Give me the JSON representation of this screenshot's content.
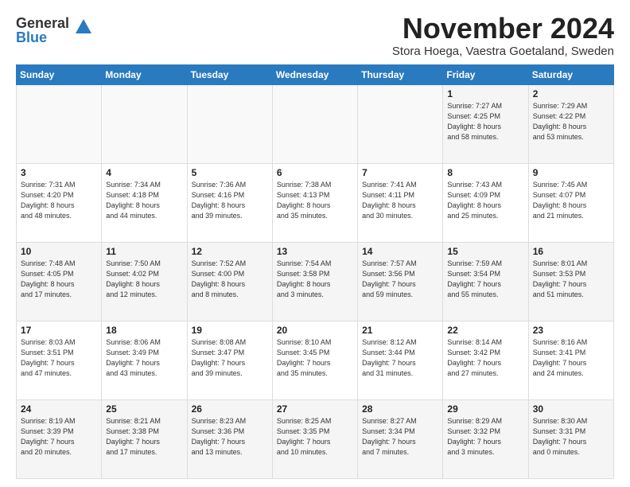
{
  "logo": {
    "general": "General",
    "blue": "Blue"
  },
  "title": "November 2024",
  "location": "Stora Hoega, Vaestra Goetaland, Sweden",
  "days_header": [
    "Sunday",
    "Monday",
    "Tuesday",
    "Wednesday",
    "Thursday",
    "Friday",
    "Saturday"
  ],
  "weeks": [
    [
      {
        "day": "",
        "info": ""
      },
      {
        "day": "",
        "info": ""
      },
      {
        "day": "",
        "info": ""
      },
      {
        "day": "",
        "info": ""
      },
      {
        "day": "",
        "info": ""
      },
      {
        "day": "1",
        "info": "Sunrise: 7:27 AM\nSunset: 4:25 PM\nDaylight: 8 hours\nand 58 minutes."
      },
      {
        "day": "2",
        "info": "Sunrise: 7:29 AM\nSunset: 4:22 PM\nDaylight: 8 hours\nand 53 minutes."
      }
    ],
    [
      {
        "day": "3",
        "info": "Sunrise: 7:31 AM\nSunset: 4:20 PM\nDaylight: 8 hours\nand 48 minutes."
      },
      {
        "day": "4",
        "info": "Sunrise: 7:34 AM\nSunset: 4:18 PM\nDaylight: 8 hours\nand 44 minutes."
      },
      {
        "day": "5",
        "info": "Sunrise: 7:36 AM\nSunset: 4:16 PM\nDaylight: 8 hours\nand 39 minutes."
      },
      {
        "day": "6",
        "info": "Sunrise: 7:38 AM\nSunset: 4:13 PM\nDaylight: 8 hours\nand 35 minutes."
      },
      {
        "day": "7",
        "info": "Sunrise: 7:41 AM\nSunset: 4:11 PM\nDaylight: 8 hours\nand 30 minutes."
      },
      {
        "day": "8",
        "info": "Sunrise: 7:43 AM\nSunset: 4:09 PM\nDaylight: 8 hours\nand 25 minutes."
      },
      {
        "day": "9",
        "info": "Sunrise: 7:45 AM\nSunset: 4:07 PM\nDaylight: 8 hours\nand 21 minutes."
      }
    ],
    [
      {
        "day": "10",
        "info": "Sunrise: 7:48 AM\nSunset: 4:05 PM\nDaylight: 8 hours\nand 17 minutes."
      },
      {
        "day": "11",
        "info": "Sunrise: 7:50 AM\nSunset: 4:02 PM\nDaylight: 8 hours\nand 12 minutes."
      },
      {
        "day": "12",
        "info": "Sunrise: 7:52 AM\nSunset: 4:00 PM\nDaylight: 8 hours\nand 8 minutes."
      },
      {
        "day": "13",
        "info": "Sunrise: 7:54 AM\nSunset: 3:58 PM\nDaylight: 8 hours\nand 3 minutes."
      },
      {
        "day": "14",
        "info": "Sunrise: 7:57 AM\nSunset: 3:56 PM\nDaylight: 7 hours\nand 59 minutes."
      },
      {
        "day": "15",
        "info": "Sunrise: 7:59 AM\nSunset: 3:54 PM\nDaylight: 7 hours\nand 55 minutes."
      },
      {
        "day": "16",
        "info": "Sunrise: 8:01 AM\nSunset: 3:53 PM\nDaylight: 7 hours\nand 51 minutes."
      }
    ],
    [
      {
        "day": "17",
        "info": "Sunrise: 8:03 AM\nSunset: 3:51 PM\nDaylight: 7 hours\nand 47 minutes."
      },
      {
        "day": "18",
        "info": "Sunrise: 8:06 AM\nSunset: 3:49 PM\nDaylight: 7 hours\nand 43 minutes."
      },
      {
        "day": "19",
        "info": "Sunrise: 8:08 AM\nSunset: 3:47 PM\nDaylight: 7 hours\nand 39 minutes."
      },
      {
        "day": "20",
        "info": "Sunrise: 8:10 AM\nSunset: 3:45 PM\nDaylight: 7 hours\nand 35 minutes."
      },
      {
        "day": "21",
        "info": "Sunrise: 8:12 AM\nSunset: 3:44 PM\nDaylight: 7 hours\nand 31 minutes."
      },
      {
        "day": "22",
        "info": "Sunrise: 8:14 AM\nSunset: 3:42 PM\nDaylight: 7 hours\nand 27 minutes."
      },
      {
        "day": "23",
        "info": "Sunrise: 8:16 AM\nSunset: 3:41 PM\nDaylight: 7 hours\nand 24 minutes."
      }
    ],
    [
      {
        "day": "24",
        "info": "Sunrise: 8:19 AM\nSunset: 3:39 PM\nDaylight: 7 hours\nand 20 minutes."
      },
      {
        "day": "25",
        "info": "Sunrise: 8:21 AM\nSunset: 3:38 PM\nDaylight: 7 hours\nand 17 minutes."
      },
      {
        "day": "26",
        "info": "Sunrise: 8:23 AM\nSunset: 3:36 PM\nDaylight: 7 hours\nand 13 minutes."
      },
      {
        "day": "27",
        "info": "Sunrise: 8:25 AM\nSunset: 3:35 PM\nDaylight: 7 hours\nand 10 minutes."
      },
      {
        "day": "28",
        "info": "Sunrise: 8:27 AM\nSunset: 3:34 PM\nDaylight: 7 hours\nand 7 minutes."
      },
      {
        "day": "29",
        "info": "Sunrise: 8:29 AM\nSunset: 3:32 PM\nDaylight: 7 hours\nand 3 minutes."
      },
      {
        "day": "30",
        "info": "Sunrise: 8:30 AM\nSunset: 3:31 PM\nDaylight: 7 hours\nand 0 minutes."
      }
    ]
  ]
}
